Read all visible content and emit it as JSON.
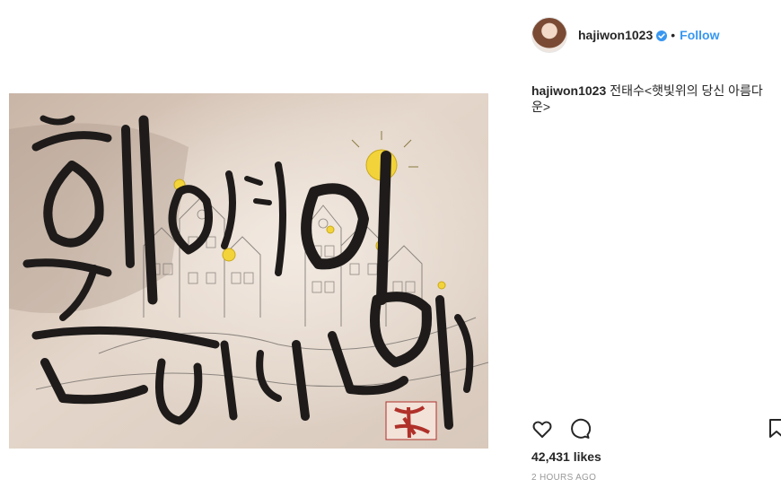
{
  "post": {
    "username": "hajiwon1023",
    "follow_label": "Follow",
    "separator": "•",
    "caption_user": "hajiwon1023",
    "caption_text": "전태수<햇빛위의 당신 아름다운>",
    "likes": "42,431 likes",
    "timestamp": "2 HOURS AGO"
  },
  "icons": {
    "verified": "verified-badge-icon",
    "like": "heart-icon",
    "comment": "comment-icon",
    "save": "bookmark-icon"
  },
  "colors": {
    "link": "#3897f0",
    "verified": "#3897f0",
    "text": "#262626",
    "muted": "#999999",
    "seal": "#b0302a",
    "sun": "#f2d43a"
  }
}
